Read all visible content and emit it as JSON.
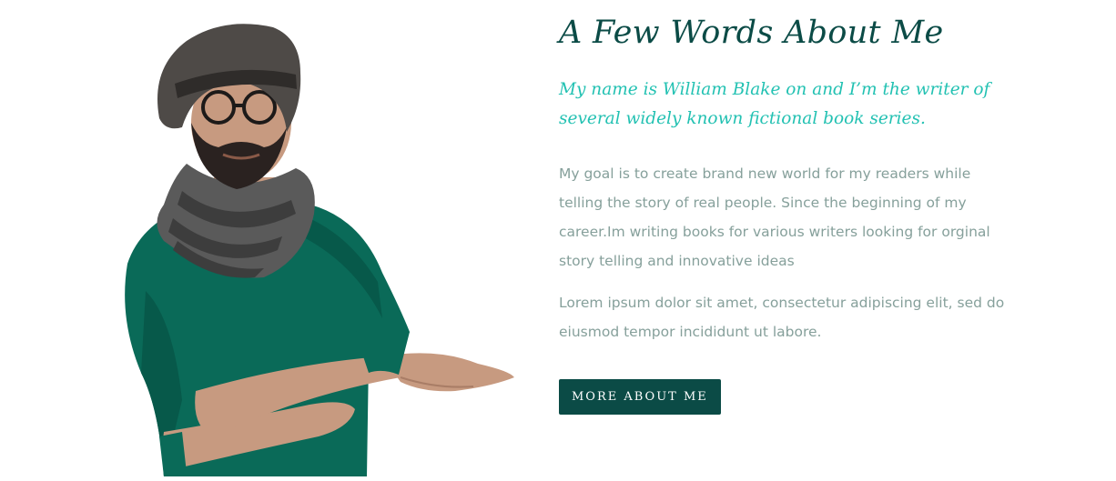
{
  "about": {
    "heading": "A Few Words About Me",
    "lead": "My name is William Blake on and I’m the writer of several widely known fictional book series.",
    "paragraphs": [
      "My goal is to create brand new world for my readers while telling the story of real people. Since the beginning of my career.Im writing books for various writers looking for orginal story telling and innovative ideas",
      "Lorem ipsum dolor sit amet, consectetur adipiscing elit, sed do eiusmod tempor incididunt ut labore."
    ],
    "button_label": "MORE ABOUT ME"
  },
  "colors": {
    "heading": "#0b4b46",
    "lead": "#22c1b2",
    "body_text": "#86a09b",
    "button_bg": "#0b4b46",
    "sweater": "#0a6a58"
  }
}
